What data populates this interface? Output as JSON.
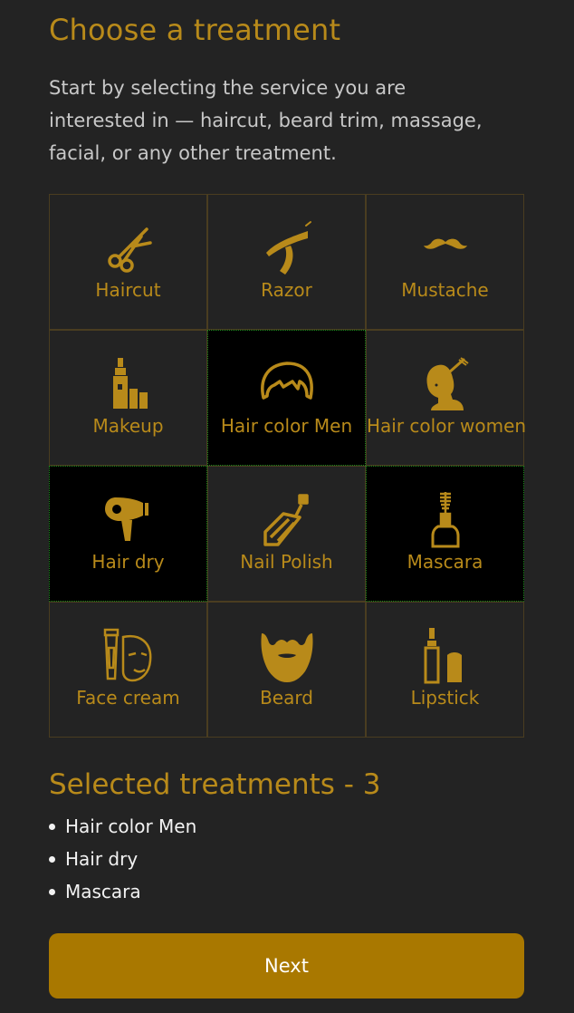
{
  "header": {
    "title": "Choose a treatment",
    "intro": "Start by selecting the service you are interested in — haircut, beard trim, massage, facial, or any other treatment."
  },
  "colors": {
    "background": "#232323",
    "accent": "#b88a1a",
    "selected_tile": "#000000",
    "selected_border": "#1e8a1e",
    "button": "#a97800"
  },
  "treatments": [
    {
      "label": "Haircut",
      "icon": "scissors-icon",
      "selected": false
    },
    {
      "label": "Razor",
      "icon": "razor-icon",
      "selected": false
    },
    {
      "label": "Mustache",
      "icon": "mustache-icon",
      "selected": false
    },
    {
      "label": "Makeup",
      "icon": "makeup-icon",
      "selected": false
    },
    {
      "label": "Hair color Men",
      "icon": "men-hair-icon",
      "selected": true
    },
    {
      "label": "Hair color women",
      "icon": "women-hair-icon",
      "selected": false
    },
    {
      "label": "Hair dry",
      "icon": "hair-dryer-icon",
      "selected": true
    },
    {
      "label": "Nail Polish",
      "icon": "nail-polish-icon",
      "selected": false
    },
    {
      "label": "Mascara",
      "icon": "mascara-icon",
      "selected": true
    },
    {
      "label": "Face cream",
      "icon": "face-cream-icon",
      "selected": false
    },
    {
      "label": "Beard",
      "icon": "beard-icon",
      "selected": false
    },
    {
      "label": "Lipstick",
      "icon": "lipstick-icon",
      "selected": false
    }
  ],
  "selection": {
    "title": "Selected treatments - 3",
    "items": [
      "Hair color Men",
      "Hair dry",
      "Mascara"
    ]
  },
  "actions": {
    "next_label": "Next"
  }
}
